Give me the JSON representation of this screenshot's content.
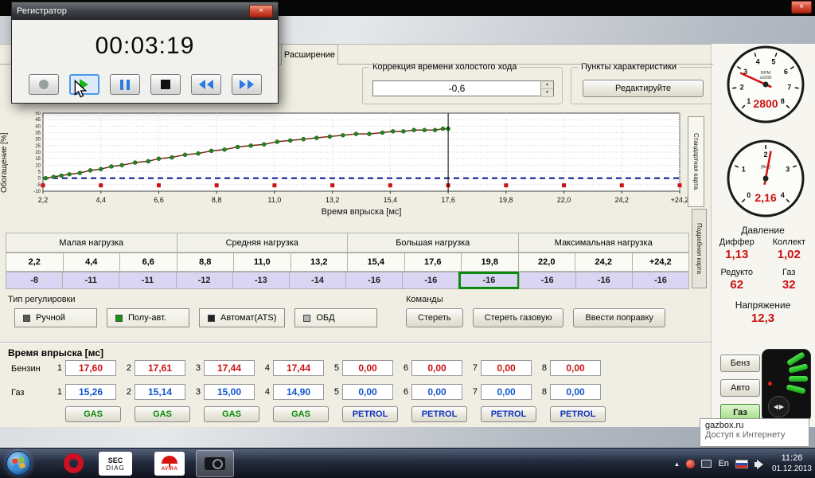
{
  "os": {
    "close_label": "×"
  },
  "recorder": {
    "title": "Регистратор",
    "timer": "00:03:19",
    "close_label": "×"
  },
  "tabs": {
    "extension": "Расширение"
  },
  "idle_correction": {
    "label": "Коррекция времени холостого хода",
    "value": "-0,6"
  },
  "characteristic_points": {
    "label": "Пункты характеристики",
    "edit_button": "Редактируйте"
  },
  "chart_data": {
    "type": "scatter",
    "xlabel": "Время впрыска [мс]",
    "ylabel": "Обогащение [%]",
    "x_tick_labels": [
      "2,2",
      "4,4",
      "6,6",
      "8,8",
      "11,0",
      "13,2",
      "15,4",
      "17,6",
      "19,8",
      "22,0",
      "24,2",
      "+24,2"
    ],
    "x_tick_values": [
      2.2,
      4.4,
      6.6,
      8.8,
      11.0,
      13.2,
      15.4,
      17.6,
      19.8,
      22.0,
      24.2,
      26.4
    ],
    "ylim": [
      -10,
      50
    ],
    "y_tick_step": 5,
    "grid": true,
    "cursor_x": 17.6,
    "baseline_y": 0,
    "marker_y": -5.5,
    "series": [
      {
        "name": "enrichment_points",
        "type": "scatter",
        "color": "#1e8a1e",
        "x": [
          2.3,
          2.6,
          2.9,
          3.2,
          3.6,
          4.0,
          4.4,
          4.8,
          5.2,
          5.7,
          6.2,
          6.6,
          7.1,
          7.6,
          8.1,
          8.6,
          9.1,
          9.6,
          10.1,
          10.6,
          11.1,
          11.6,
          12.1,
          12.6,
          13.1,
          13.6,
          14.1,
          14.6,
          15.1,
          15.5,
          15.9,
          16.3,
          16.7,
          17.1,
          17.4,
          17.6
        ],
        "y": [
          0,
          1,
          2,
          3,
          4,
          6,
          7,
          9,
          10,
          12,
          13,
          15,
          16,
          18,
          19,
          21,
          22,
          24,
          25,
          26,
          28,
          29,
          30,
          31,
          32,
          33,
          34,
          34,
          35,
          36,
          36,
          37,
          37,
          37,
          38,
          38
        ]
      },
      {
        "name": "trend_line",
        "type": "line",
        "color": "#7a2a1a"
      },
      {
        "name": "baseline",
        "type": "dashed_line",
        "color": "#001489"
      },
      {
        "name": "axis_markers",
        "type": "squares",
        "color": "#cc1111"
      }
    ]
  },
  "side_tabs": {
    "standard": "Стандартная карта",
    "detailed": "Подробная карта"
  },
  "load_table": {
    "headers": [
      "Малая  нагрузка",
      "Средняя нагрузка",
      "Большая нагрузка",
      "Максимальная нагрузка"
    ],
    "columns": [
      "2,2",
      "4,4",
      "6,6",
      "8,8",
      "11,0",
      "13,2",
      "15,4",
      "17,6",
      "19,8",
      "22,0",
      "24,2",
      "+24,2"
    ],
    "values": [
      "-8",
      "-11",
      "-11",
      "-12",
      "-13",
      "-14",
      "-16",
      "-16",
      "-16",
      "-16",
      "-16",
      "-16"
    ],
    "selected_index": 8
  },
  "regulation": {
    "label": "Тип регулировки",
    "options": [
      {
        "label": "Ручной",
        "color": "#5a5a5a",
        "active": false
      },
      {
        "label": "Полу-авт.",
        "color": "#119911",
        "active": true
      },
      {
        "label": "Автомат(ATS)",
        "color": "#222222",
        "active": false
      },
      {
        "label": "ОБД",
        "color": "#b4b4b4",
        "active": false
      }
    ]
  },
  "commands": {
    "label": "Команды",
    "buttons": [
      "Стереть",
      "Стереть газовую",
      "Ввести поправку"
    ]
  },
  "injection": {
    "title": "Время впрыска [мс]",
    "rows": [
      {
        "label": "Бензин",
        "color": "#cc1111",
        "values": [
          "17,60",
          "17,61",
          "17,44",
          "17,44",
          "0,00",
          "0,00",
          "0,00",
          "0,00"
        ]
      },
      {
        "label": "Газ",
        "color": "#1155cc",
        "values": [
          "15,26",
          "15,14",
          "15,00",
          "14,90",
          "0,00",
          "0,00",
          "0,00",
          "0,00"
        ]
      }
    ],
    "channel_buttons": [
      {
        "label": "GAS",
        "color": "#0a8a0a"
      },
      {
        "label": "GAS",
        "color": "#0a8a0a"
      },
      {
        "label": "GAS",
        "color": "#0a8a0a"
      },
      {
        "label": "GAS",
        "color": "#0a8a0a"
      },
      {
        "label": "PETROL",
        "color": "#1133bb"
      },
      {
        "label": "PETROL",
        "color": "#1133bb"
      },
      {
        "label": "PETROL",
        "color": "#1133bb"
      },
      {
        "label": "PETROL",
        "color": "#1133bb"
      }
    ]
  },
  "gauges": {
    "rpm": {
      "ticks": [
        "1",
        "2",
        "3",
        "4",
        "5",
        "6",
        "7",
        "8"
      ],
      "min": 1,
      "max": 8,
      "value": 2.8,
      "display": "2800",
      "unit_top": "RPM",
      "unit_bottom": "x1000"
    },
    "pressure": {
      "ticks": [
        "0",
        "1",
        "2",
        "3",
        "4"
      ],
      "min": 0,
      "max": 4,
      "value": 2.16,
      "display": "2,16",
      "unit_top": "[Bar]",
      "unit_bottom": ""
    }
  },
  "readings": {
    "pressure_title": "Давление",
    "cols": [
      {
        "label": "Диффер",
        "value": "1,13"
      },
      {
        "label": "Коллект",
        "value": "1,02"
      }
    ],
    "cols2": [
      {
        "label": "Редукто",
        "value": "62"
      },
      {
        "label": "Газ",
        "value": "32"
      }
    ],
    "voltage_label": "Напряжение",
    "voltage_value": "12,3"
  },
  "fuel_selector": [
    {
      "label": "Бенз",
      "active": false
    },
    {
      "label": "Авто",
      "active": false
    },
    {
      "label": "Газ",
      "active": true
    }
  ],
  "tooltip": {
    "line1": "gazbox.ru",
    "line2": "Доступ к Интернету"
  },
  "taskbar": {
    "sec_line1": "SEC",
    "sec_line2": "DIAG",
    "avira": "AVIRA",
    "lang": "En",
    "time": "11:26",
    "date": "01.12.2013"
  }
}
